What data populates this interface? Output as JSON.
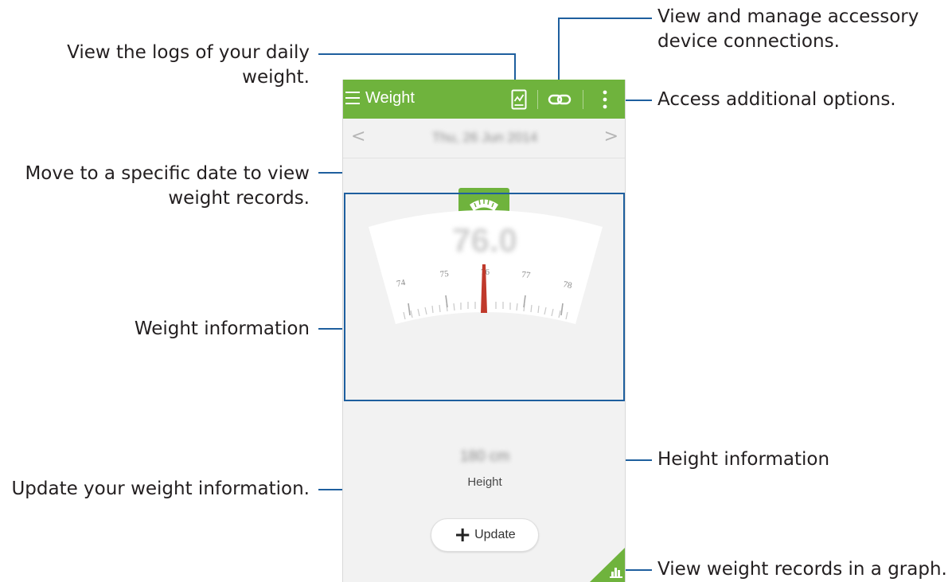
{
  "app_bar": {
    "title": "Weight",
    "icons": [
      "menu-icon",
      "log-icon",
      "link-icon",
      "more-options-icon"
    ],
    "color": "#6fb33d"
  },
  "date_nav": {
    "prev_symbol": "<",
    "next_symbol": ">",
    "date": "Thu, 26 Jun 2014"
  },
  "scale_icon": "scale-icon",
  "weight": {
    "value": "76.0",
    "ticks": [
      "74",
      "75",
      "76",
      "77",
      "78"
    ],
    "needle_color": "#c0392b"
  },
  "height": {
    "value": "180 cm",
    "label": "Height"
  },
  "update_button": {
    "icon": "+",
    "label": "Update"
  },
  "graph_button_icon": "bar-chart-icon",
  "callouts": {
    "logs": "View the logs of your daily\nweight.",
    "connections": "View and manage accessory\ndevice connections.",
    "options": "Access additional options.",
    "date": "Move to a specific date to view\nweight records.",
    "weight_info": "Weight information",
    "height_info": "Height information",
    "update": "Update your weight information.",
    "graph": "View weight records in a graph."
  },
  "callout_line_color": "#1e5f9e"
}
